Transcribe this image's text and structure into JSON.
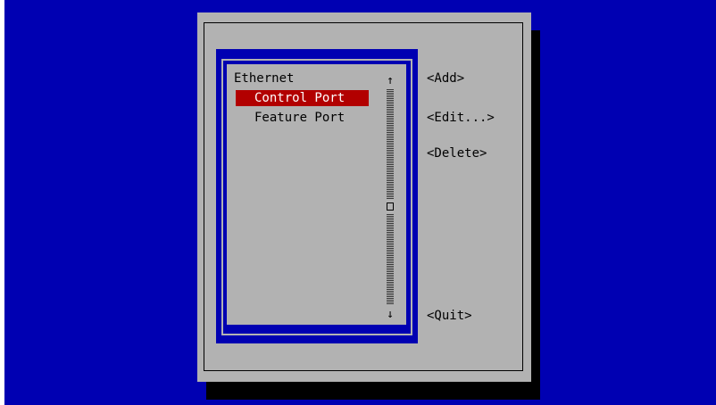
{
  "list": {
    "group": "Ethernet",
    "items": [
      {
        "label": "Control Port",
        "selected": true
      },
      {
        "label": "Feature Port",
        "selected": false
      }
    ]
  },
  "scrollbar": {
    "up_arrow": "↑",
    "down_arrow": "↓",
    "track_icon": "hatched-track",
    "thumb_icon": "square-thumb"
  },
  "actions": {
    "add": "<Add>",
    "edit": "<Edit...>",
    "delete": "<Delete>",
    "quit": "<Quit>"
  },
  "colors": {
    "background": "#0000b2",
    "dialog": "#b2b2b2",
    "selection": "#b20000",
    "selection_text": "#ffffff",
    "shadow": "#000000"
  }
}
